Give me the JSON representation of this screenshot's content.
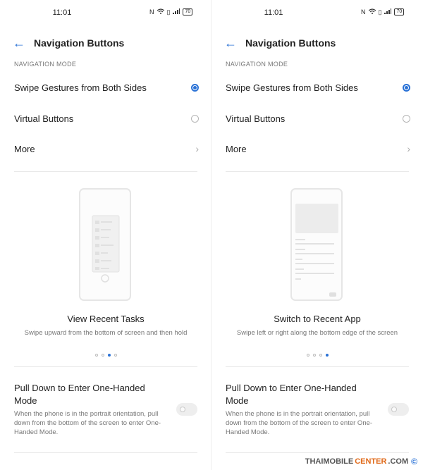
{
  "panels": [
    {
      "status": {
        "time": "11:01",
        "battery": "70"
      },
      "header": {
        "title": "Navigation Buttons"
      },
      "section_label": "NAVIGATION MODE",
      "options": [
        {
          "label": "Swipe Gestures from Both Sides",
          "selected": true
        },
        {
          "label": "Virtual Buttons",
          "selected": false
        }
      ],
      "more_label": "More",
      "illustration": {
        "caption": "View Recent Tasks",
        "description": "Swipe upward from the bottom of screen and then hold",
        "page_index": 3,
        "page_count": 4
      },
      "one_handed": {
        "title": "Pull Down to Enter One-Handed Mode",
        "description": "When the phone is in the portrait orientation, pull down from the bottom of the screen to enter One-Handed Mode.",
        "enabled": false
      }
    },
    {
      "status": {
        "time": "11:01",
        "battery": "70"
      },
      "header": {
        "title": "Navigation Buttons"
      },
      "section_label": "NAVIGATION MODE",
      "options": [
        {
          "label": "Swipe Gestures from Both Sides",
          "selected": true
        },
        {
          "label": "Virtual Buttons",
          "selected": false
        }
      ],
      "more_label": "More",
      "illustration": {
        "caption": "Switch to Recent App",
        "description": "Swipe left or right along the bottom edge of the screen",
        "page_index": 4,
        "page_count": 4
      },
      "one_handed": {
        "title": "Pull Down to Enter One-Handed Mode",
        "description": "When the phone is in the portrait orientation, pull down from the bottom of the screen to enter One-Handed Mode.",
        "enabled": false
      }
    }
  ],
  "watermark": {
    "part1": "THAIMOBILE",
    "part2": "CENTER",
    "part3": ".COM",
    "symbol": "©"
  },
  "colors": {
    "accent": "#2a72d6",
    "watermark_orange": "#e06a1a"
  }
}
